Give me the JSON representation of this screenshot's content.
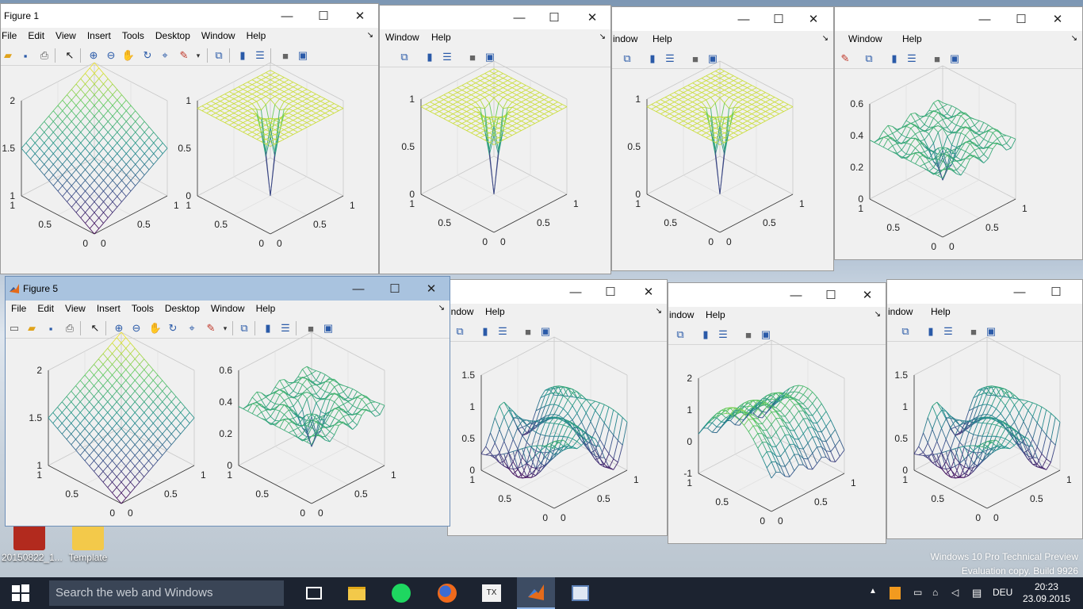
{
  "desktop": {
    "icons": [
      {
        "label": "20150822_1..."
      },
      {
        "label": "Template"
      }
    ],
    "watermark": [
      "Windows 10 Pro Technical Preview",
      "Evaluation copy. Build 9926"
    ]
  },
  "menus": {
    "full": [
      "File",
      "Edit",
      "View",
      "Insert",
      "Tools",
      "Desktop",
      "Window",
      "Help"
    ],
    "partial_window": "Window",
    "partial_window_cut": "indow",
    "partial_help": "Help"
  },
  "windows": {
    "figure1": {
      "title": "Figure 1"
    },
    "figure5": {
      "title": "Figure 5"
    }
  },
  "plots": {
    "plane": {
      "z": [
        "2",
        "1.5",
        "1"
      ],
      "x": [
        "1",
        "0.5",
        "0"
      ],
      "y": [
        "0",
        "0.5",
        "1"
      ]
    },
    "hole": {
      "z": [
        "1",
        "0.5",
        "0"
      ],
      "x": [
        "1",
        "0.5",
        "0"
      ],
      "y": [
        "0",
        "0.5",
        "1"
      ]
    },
    "noisy06": {
      "z": [
        "0.6",
        "0.4",
        "0.2",
        "0"
      ],
      "x": [
        "1",
        "0.5",
        "0"
      ],
      "y": [
        "0",
        "0.5",
        "1"
      ]
    },
    "bumpy15": {
      "z": [
        "1.5",
        "1",
        "0.5",
        "0"
      ],
      "x": [
        "1",
        "0.5",
        "0"
      ],
      "y": [
        "0",
        "0.5",
        "1"
      ]
    },
    "ridge2": {
      "z": [
        "2",
        "1",
        "0",
        "-1"
      ],
      "x": [
        "1",
        "0.5",
        "0"
      ],
      "y": [
        "0",
        "0.5",
        "1"
      ]
    }
  },
  "taskbar": {
    "search_placeholder": "Search the web and Windows",
    "language": "DEU",
    "time": "20:23",
    "date": "23.09.2015"
  }
}
